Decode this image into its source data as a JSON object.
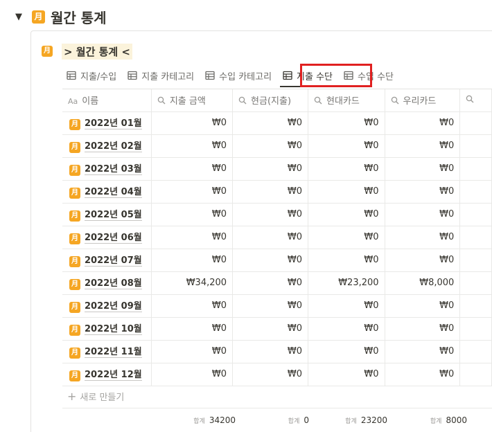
{
  "header": {
    "title": "월간 통계",
    "icon_glyph": "月",
    "toggle_icon": "triangle-down-icon"
  },
  "database": {
    "title": "> 월간 통계 <",
    "icon_glyph": "月"
  },
  "tabs": [
    {
      "label": "지출/수입",
      "active": false
    },
    {
      "label": "지출 카테고리",
      "active": false
    },
    {
      "label": "수입 카테고리",
      "active": false
    },
    {
      "label": "지출 수단",
      "active": true
    },
    {
      "label": "수입 수단",
      "active": false
    }
  ],
  "columns": [
    {
      "label": "이름",
      "icon": "Aa"
    },
    {
      "label": "지출 금액",
      "icon": "search"
    },
    {
      "label": "현금(지출)",
      "icon": "search"
    },
    {
      "label": "현대카드",
      "icon": "search"
    },
    {
      "label": "우리카드",
      "icon": "search"
    },
    {
      "label": "",
      "icon": "search"
    }
  ],
  "rows": [
    {
      "name": "2022년 01월",
      "values": [
        "₩0",
        "₩0",
        "₩0",
        "₩0"
      ]
    },
    {
      "name": "2022년 02월",
      "values": [
        "₩0",
        "₩0",
        "₩0",
        "₩0"
      ]
    },
    {
      "name": "2022년 03월",
      "values": [
        "₩0",
        "₩0",
        "₩0",
        "₩0"
      ]
    },
    {
      "name": "2022년 04월",
      "values": [
        "₩0",
        "₩0",
        "₩0",
        "₩0"
      ]
    },
    {
      "name": "2022년 05월",
      "values": [
        "₩0",
        "₩0",
        "₩0",
        "₩0"
      ]
    },
    {
      "name": "2022년 06월",
      "values": [
        "₩0",
        "₩0",
        "₩0",
        "₩0"
      ]
    },
    {
      "name": "2022년 07월",
      "values": [
        "₩0",
        "₩0",
        "₩0",
        "₩0"
      ]
    },
    {
      "name": "2022년 08월",
      "values": [
        "₩34,200",
        "₩0",
        "₩23,200",
        "₩8,000"
      ]
    },
    {
      "name": "2022년 09월",
      "values": [
        "₩0",
        "₩0",
        "₩0",
        "₩0"
      ]
    },
    {
      "name": "2022년 10월",
      "values": [
        "₩0",
        "₩0",
        "₩0",
        "₩0"
      ]
    },
    {
      "name": "2022년 11월",
      "values": [
        "₩0",
        "₩0",
        "₩0",
        "₩0"
      ]
    },
    {
      "name": "2022년 12월",
      "values": [
        "₩0",
        "₩0",
        "₩0",
        "₩0"
      ]
    }
  ],
  "new_row_label": "새로 만들기",
  "sums": [
    {
      "label": "합계",
      "value": "34200"
    },
    {
      "label": "합계",
      "value": "0"
    },
    {
      "label": "합계",
      "value": "23200"
    },
    {
      "label": "합계",
      "value": "8000"
    }
  ],
  "colors": {
    "accent_icon": "#f5a623",
    "highlight_box": "#e02020",
    "title_highlight": "#fbf3db"
  }
}
